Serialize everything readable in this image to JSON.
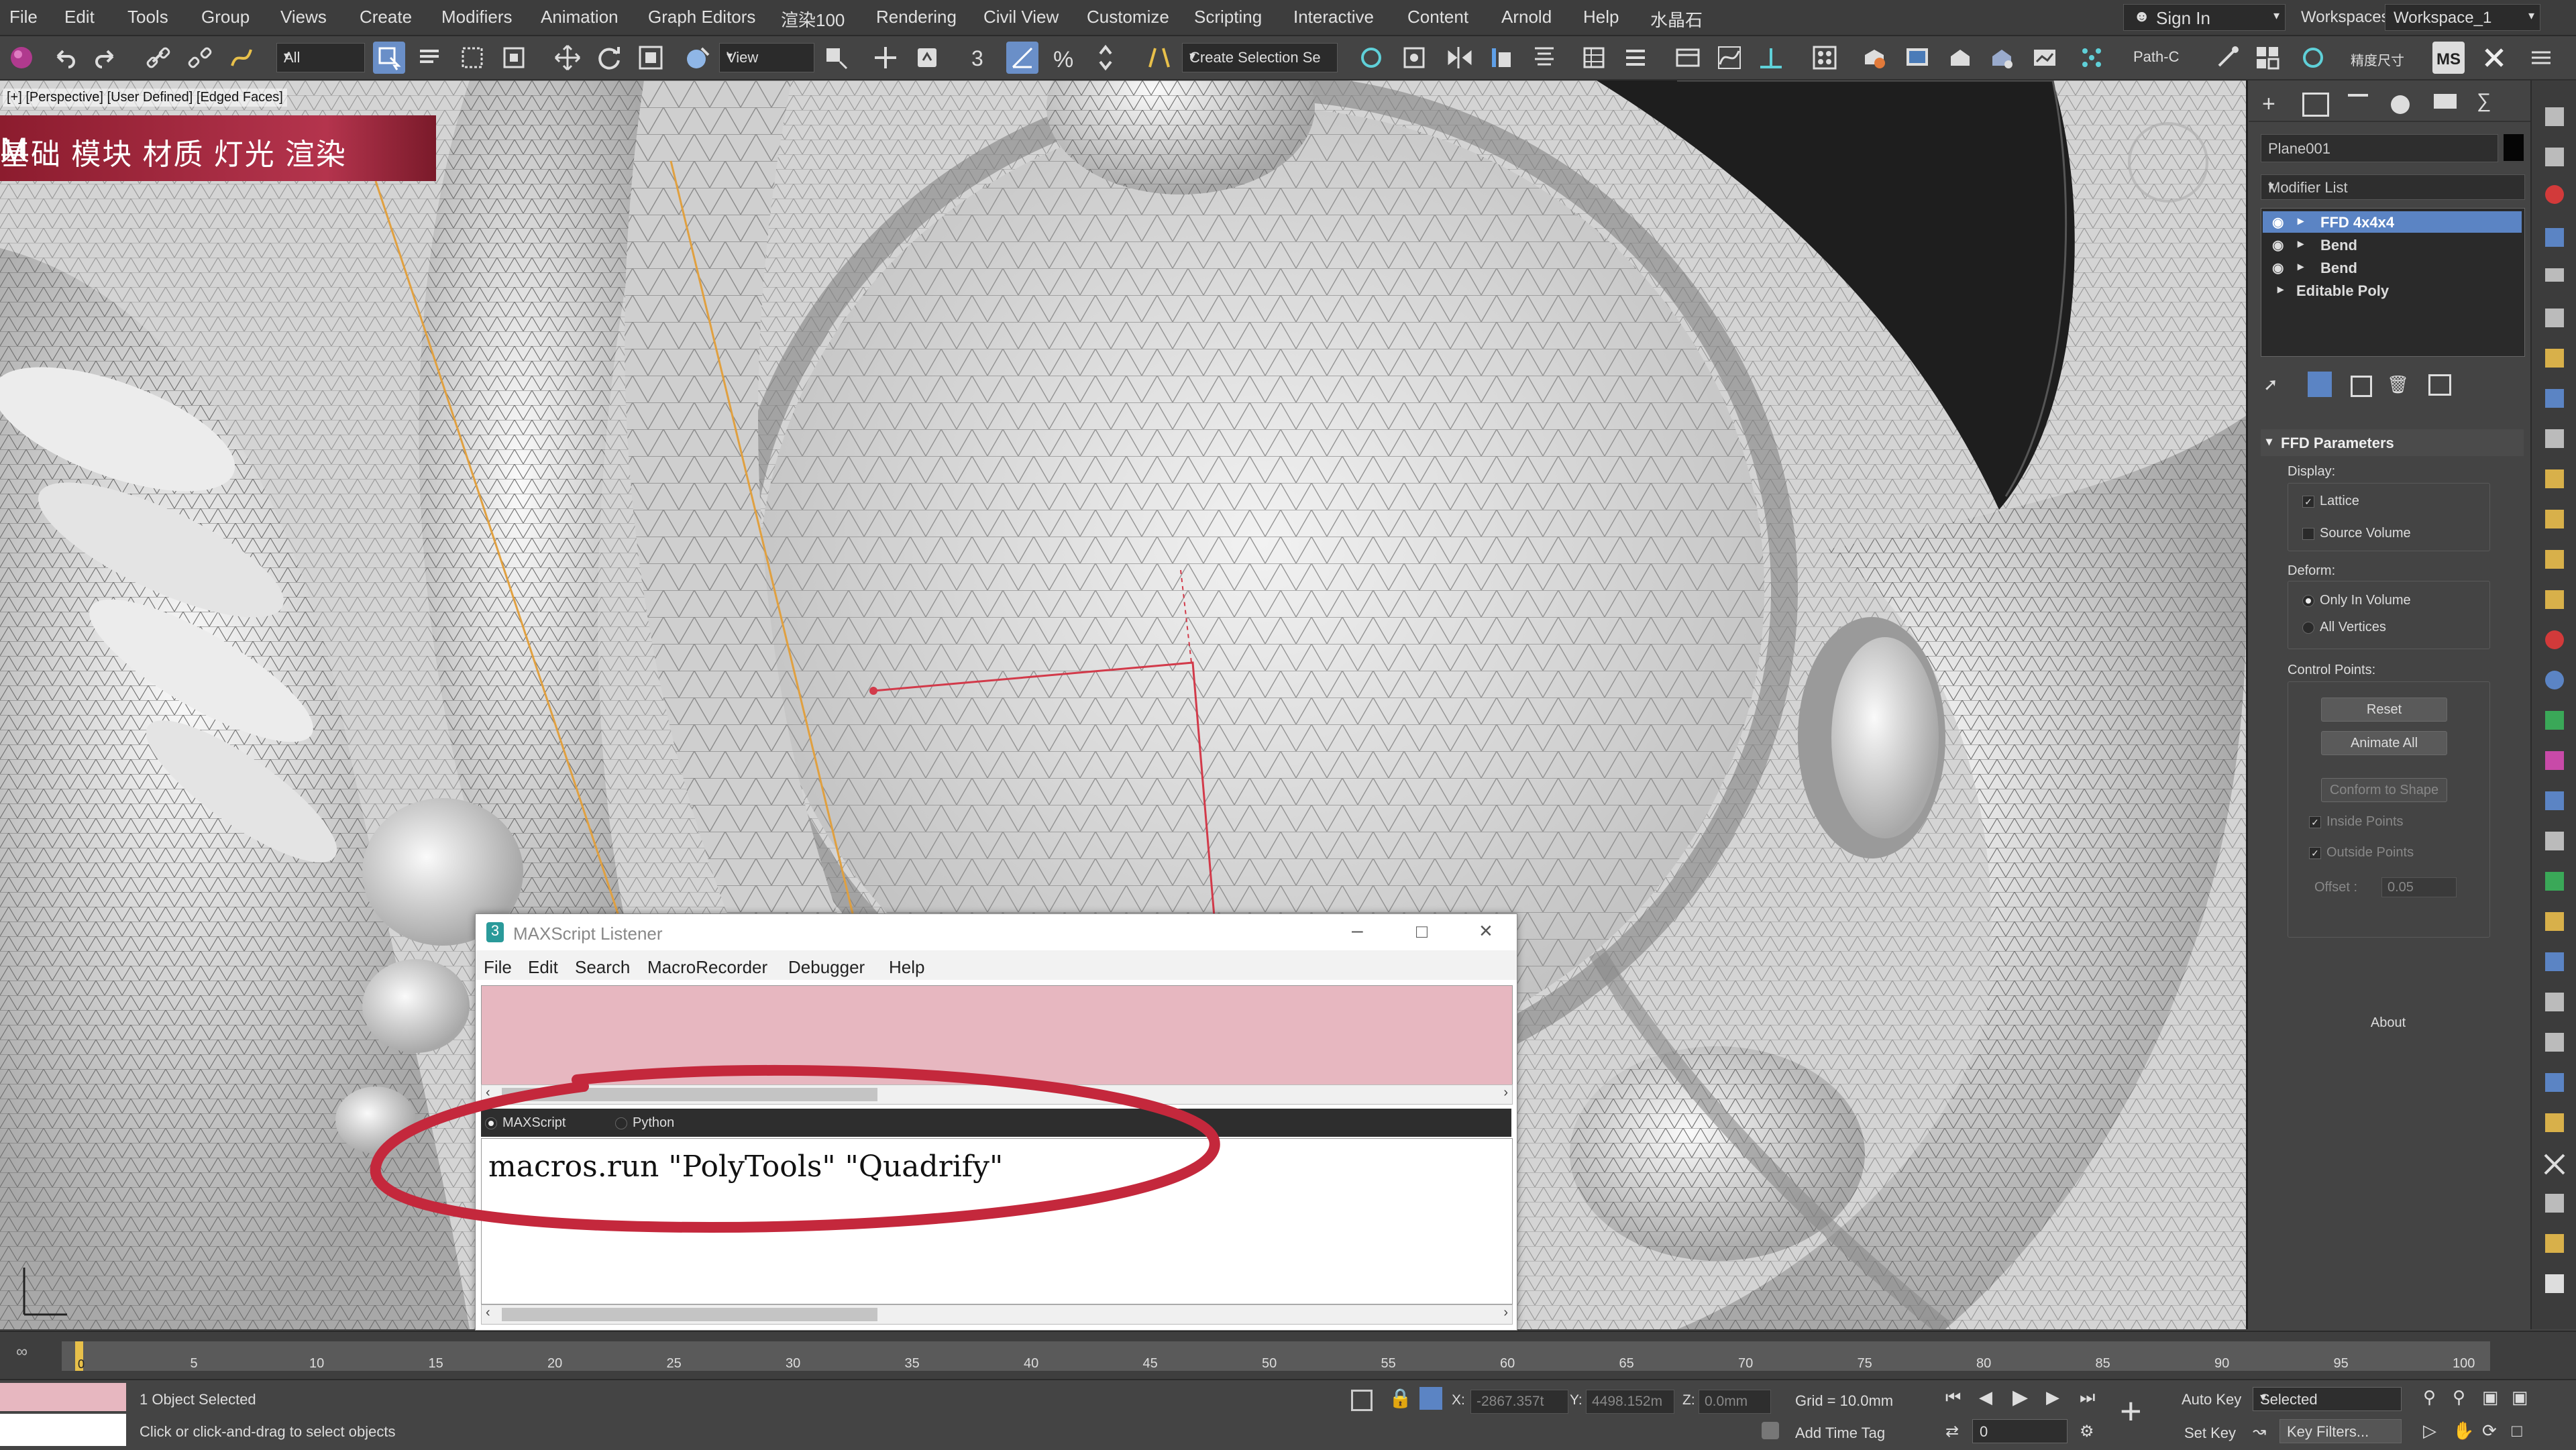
{
  "menu": [
    "File",
    "Edit",
    "Tools",
    "Group",
    "Views",
    "Create",
    "Modifiers",
    "Animation",
    "Graph Editors",
    "渲染100",
    "Rendering",
    "Civil View",
    "Customize",
    "Scripting",
    "Interactive",
    "Content",
    "Arnold",
    "Help",
    "水晶石"
  ],
  "account": {
    "sign_in": "Sign In",
    "workspaces_label": "Workspaces:",
    "workspace": "Workspace_1"
  },
  "toolbar": {
    "filter": "All",
    "ref_coord": "View",
    "selection_set": "Create Selection Se",
    "path_label": "Path-C",
    "cn_label": "精度尺寸",
    "snap_text": "3",
    "ms_label": "MS"
  },
  "viewport": {
    "label": "[+] [Perspective] [User Defined] [Edged Faces]",
    "banner": "基础 模块 材质 灯光 渲染",
    "banner_logo": "M"
  },
  "listener": {
    "title": "MAXScript Listener",
    "menu": [
      "File",
      "Edit",
      "Search",
      "MacroRecorder",
      "Debugger",
      "Help"
    ],
    "modes": [
      "MAXScript",
      "Python"
    ],
    "code": "macros.run \"PolyTools\" \"Quadrify\""
  },
  "command_panel": {
    "object_name": "Plane001",
    "modifier_list": "Modifier List",
    "stack": [
      {
        "label": "FFD 4x4x4",
        "selected": true
      },
      {
        "label": "Bend",
        "selected": false
      },
      {
        "label": "Bend",
        "selected": false
      },
      {
        "label": "Editable Poly",
        "selected": false
      }
    ],
    "rollout_title": "FFD Parameters",
    "display_label": "Display:",
    "lattice": "Lattice",
    "source_volume": "Source Volume",
    "deform_label": "Deform:",
    "only_in_volume": "Only In Volume",
    "all_vertices": "All Vertices",
    "control_points_label": "Control Points:",
    "reset": "Reset",
    "animate_all": "Animate All",
    "conform": "Conform to Shape",
    "inside_points": "Inside Points",
    "outside_points": "Outside Points",
    "offset_label": "Offset :",
    "offset_value": "0.05",
    "about": "About"
  },
  "timeline": {
    "frame": "0",
    "ticks": [
      "5",
      "10",
      "15",
      "20",
      "25",
      "30",
      "35",
      "40",
      "45",
      "50",
      "55",
      "60",
      "65",
      "70",
      "75",
      "80",
      "85",
      "90",
      "95",
      "100"
    ]
  },
  "status": {
    "selected": "1 Object Selected",
    "prompt": "Click or click-and-drag to select objects",
    "x_label": "X:",
    "x_value": "-2867.357t",
    "y_label": "Y:",
    "y_value": "4498.152m",
    "z_label": "Z:",
    "z_value": "0.0mm",
    "grid": "Grid = 10.0mm",
    "add_time_tag": "Add Time Tag",
    "auto_key": "Auto Key",
    "set_key": "Set Key",
    "selected_mode": "Selected",
    "key_filters": "Key Filters...",
    "frame_field": "0"
  },
  "colors": {
    "accent": "#5b84c4",
    "banner": "#b4344d",
    "listener_output": "#e7b7c0",
    "annotation": "#c4283c"
  }
}
